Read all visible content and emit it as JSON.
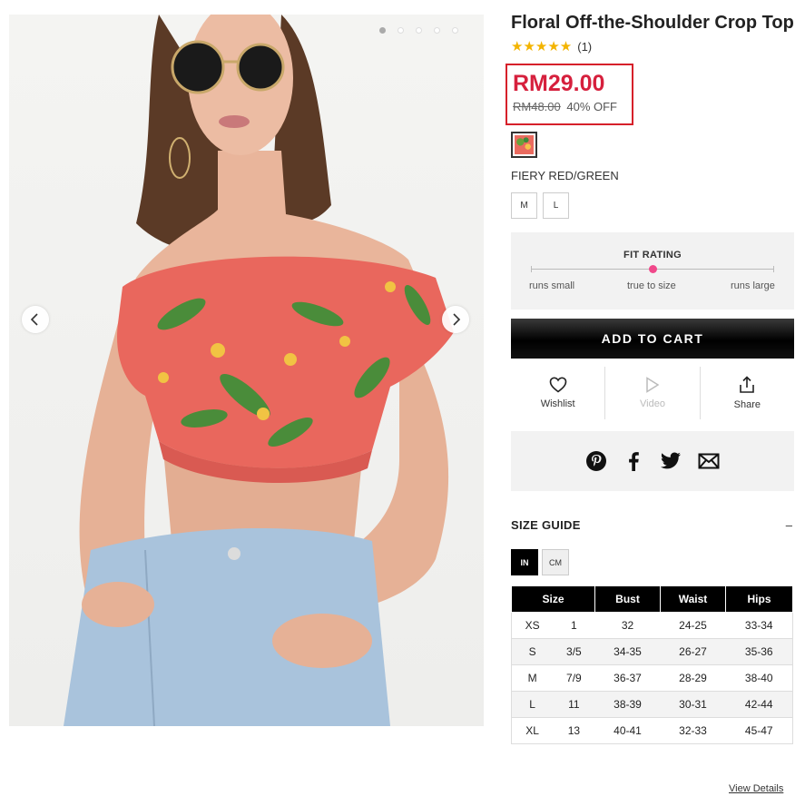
{
  "product": {
    "title": "Floral Off-the-Shoulder Crop Top",
    "rating_stars": "★★★★★",
    "rating_value": 5,
    "review_count": "(1)",
    "price_now": "RM29.00",
    "price_was": "RM48.00",
    "discount": "40% OFF",
    "color_name": "FIERY RED/GREEN",
    "sizes": [
      "M",
      "L"
    ]
  },
  "gallery": {
    "image_count": 5,
    "active_index": 0,
    "prev_icon": "chevron-left-icon",
    "next_icon": "chevron-right-icon"
  },
  "fit": {
    "title": "FIT RATING",
    "labels": [
      "runs small",
      "true to size",
      "runs large"
    ],
    "value": 0.5
  },
  "cart": {
    "label": "ADD TO CART"
  },
  "actions": {
    "wishlist": {
      "label": "Wishlist",
      "icon": "heart-icon"
    },
    "video": {
      "label": "Video",
      "icon": "play-icon"
    },
    "share": {
      "label": "Share",
      "icon": "share-icon"
    }
  },
  "social": [
    "pinterest-icon",
    "facebook-icon",
    "twitter-icon",
    "email-icon"
  ],
  "size_guide": {
    "title": "SIZE GUIDE",
    "toggle": "–",
    "units": [
      "IN",
      "CM"
    ],
    "active_unit": "IN",
    "headers": [
      "Size",
      "Bust",
      "Waist",
      "Hips"
    ],
    "rows": [
      [
        "XS",
        "1",
        "32",
        "24-25",
        "33-34"
      ],
      [
        "S",
        "3/5",
        "34-35",
        "26-27",
        "35-36"
      ],
      [
        "M",
        "7/9",
        "36-37",
        "28-29",
        "38-40"
      ],
      [
        "L",
        "11",
        "38-39",
        "30-31",
        "42-44"
      ],
      [
        "XL",
        "13",
        "40-41",
        "32-33",
        "45-47"
      ]
    ],
    "view_details": "View Details"
  },
  "colors": {
    "price_red": "#d6203d",
    "star_gold": "#f3b400",
    "fit_pink": "#f0488a",
    "cart_black": "#000000"
  }
}
